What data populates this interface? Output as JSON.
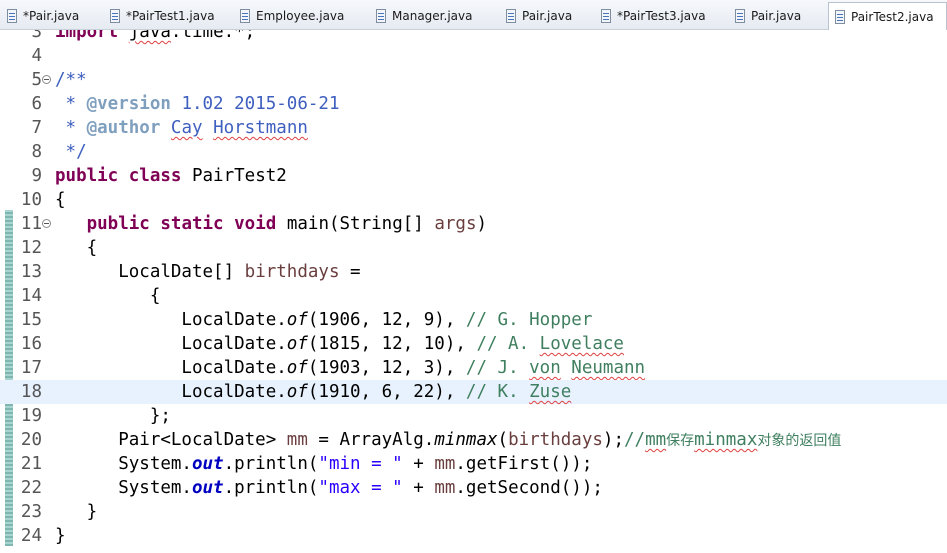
{
  "tabs": [
    {
      "label": "*Pair.java"
    },
    {
      "label": "*PairTest1.java"
    },
    {
      "label": "Employee.java"
    },
    {
      "label": "Manager.java"
    },
    {
      "label": "Pair.java"
    },
    {
      "label": "*PairTest3.java"
    },
    {
      "label": "Pair.java"
    },
    {
      "label": "PairTest2.java",
      "active": true
    }
  ],
  "editor": {
    "current_line": "18",
    "lines": [
      {
        "n": "3",
        "fold": false,
        "tokens": [
          [
            "kw",
            "import"
          ],
          [
            "n",
            " "
          ],
          [
            "sq",
            "java"
          ],
          [
            "n",
            ".time.*;"
          ]
        ]
      },
      {
        "n": "4",
        "fold": false,
        "tokens": []
      },
      {
        "n": "5",
        "fold": true,
        "tokens": [
          [
            "jd",
            "/**"
          ]
        ]
      },
      {
        "n": "6",
        "fold": false,
        "tokens": [
          [
            "jd",
            " * "
          ],
          [
            "jdtag",
            "@version"
          ],
          [
            "jd",
            " 1.02 2015-06-21"
          ]
        ]
      },
      {
        "n": "7",
        "fold": false,
        "tokens": [
          [
            "jd",
            " * "
          ],
          [
            "jdtag",
            "@author"
          ],
          [
            "jd",
            " "
          ],
          [
            "jd sq",
            "Cay"
          ],
          [
            "jd",
            " "
          ],
          [
            "jd sq",
            "Horstmann"
          ]
        ]
      },
      {
        "n": "8",
        "fold": false,
        "tokens": [
          [
            "jd",
            " */"
          ]
        ]
      },
      {
        "n": "9",
        "fold": false,
        "tokens": [
          [
            "kw",
            "public"
          ],
          [
            "n",
            " "
          ],
          [
            "kw",
            "class"
          ],
          [
            "n",
            " PairTest2"
          ]
        ]
      },
      {
        "n": "10",
        "fold": false,
        "tokens": [
          [
            "n",
            "{"
          ]
        ]
      },
      {
        "n": "11",
        "fold": true,
        "tokens": [
          [
            "n",
            "   "
          ],
          [
            "kw",
            "public"
          ],
          [
            "n",
            " "
          ],
          [
            "kw",
            "static"
          ],
          [
            "n",
            " "
          ],
          [
            "kw",
            "void"
          ],
          [
            "n",
            " main(String[] "
          ],
          [
            "var",
            "args"
          ],
          [
            "n",
            ")"
          ]
        ]
      },
      {
        "n": "12",
        "fold": false,
        "tokens": [
          [
            "n",
            "   {"
          ]
        ]
      },
      {
        "n": "13",
        "fold": false,
        "tokens": [
          [
            "n",
            "      LocalDate[] "
          ],
          [
            "var",
            "birthdays"
          ],
          [
            "n",
            " ="
          ]
        ]
      },
      {
        "n": "14",
        "fold": false,
        "tokens": [
          [
            "n",
            "         {"
          ]
        ]
      },
      {
        "n": "15",
        "fold": false,
        "tokens": [
          [
            "n",
            "            LocalDate."
          ],
          [
            "it",
            "of"
          ],
          [
            "n",
            "(1906, 12, 9), "
          ],
          [
            "cm",
            "// G. Hopper"
          ]
        ]
      },
      {
        "n": "16",
        "fold": false,
        "tokens": [
          [
            "n",
            "            LocalDate."
          ],
          [
            "it",
            "of"
          ],
          [
            "n",
            "(1815, 12, 10), "
          ],
          [
            "cm",
            "// A. "
          ],
          [
            "cm sq",
            "Lovelace"
          ]
        ]
      },
      {
        "n": "17",
        "fold": false,
        "tokens": [
          [
            "n",
            "            LocalDate."
          ],
          [
            "it",
            "of"
          ],
          [
            "n",
            "(1903, 12, 3), "
          ],
          [
            "cm",
            "// J. "
          ],
          [
            "cm sq",
            "von"
          ],
          [
            "cm",
            " "
          ],
          [
            "cm sq",
            "Neumann"
          ]
        ]
      },
      {
        "n": "18",
        "fold": false,
        "tokens": [
          [
            "n",
            "            LocalDate."
          ],
          [
            "it",
            "of"
          ],
          [
            "n",
            "(1910, 6, 22), "
          ],
          [
            "cm",
            "// K. "
          ],
          [
            "cm sq",
            "Zuse"
          ]
        ]
      },
      {
        "n": "19",
        "fold": false,
        "tokens": [
          [
            "n",
            "         };"
          ]
        ]
      },
      {
        "n": "20",
        "fold": false,
        "tokens": [
          [
            "n",
            "      Pair<LocalDate> "
          ],
          [
            "var",
            "mm"
          ],
          [
            "n",
            " = ArrayAlg."
          ],
          [
            "it",
            "minmax"
          ],
          [
            "n",
            "("
          ],
          [
            "var",
            "birthdays"
          ],
          [
            "n",
            ");"
          ],
          [
            "cm",
            "//"
          ],
          [
            "cm sq",
            "mm"
          ],
          [
            "cm cjk",
            "保存"
          ],
          [
            "cm sq",
            "minmax"
          ],
          [
            "cm cjk",
            "对象的返回值"
          ]
        ]
      },
      {
        "n": "21",
        "fold": false,
        "tokens": [
          [
            "n",
            "      System."
          ],
          [
            "fld",
            "out"
          ],
          [
            "n",
            ".println("
          ],
          [
            "str",
            "\"min = \""
          ],
          [
            "n",
            " + "
          ],
          [
            "var",
            "mm"
          ],
          [
            "n",
            ".getFirst());"
          ]
        ]
      },
      {
        "n": "22",
        "fold": false,
        "tokens": [
          [
            "n",
            "      System."
          ],
          [
            "fld",
            "out"
          ],
          [
            "n",
            ".println("
          ],
          [
            "str",
            "\"max = \""
          ],
          [
            "n",
            " + "
          ],
          [
            "var",
            "mm"
          ],
          [
            "n",
            ".getSecond());"
          ]
        ]
      },
      {
        "n": "23",
        "fold": false,
        "tokens": [
          [
            "n",
            "   }"
          ]
        ]
      },
      {
        "n": "24",
        "fold": false,
        "tokens": [
          [
            "n",
            "}"
          ]
        ]
      }
    ]
  }
}
